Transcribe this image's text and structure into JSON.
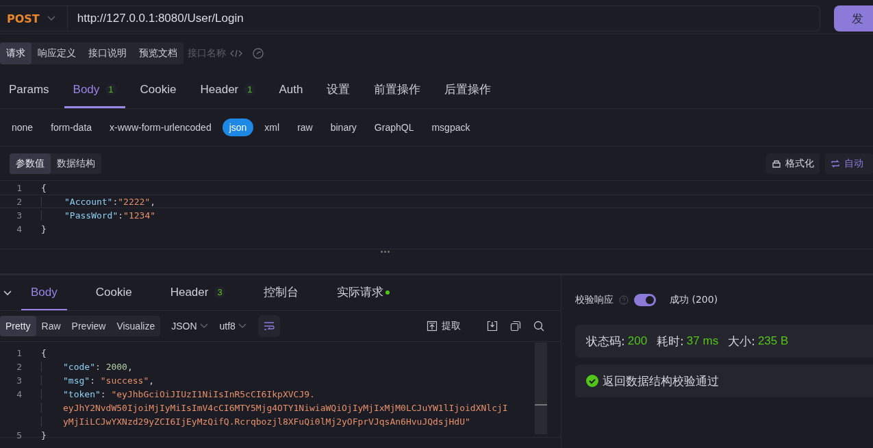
{
  "request_bar": {
    "method": "POST",
    "url": "http://127.0.0.1:8080/User/Login",
    "send_label": "发"
  },
  "doc_tabs": [
    {
      "label": "请求",
      "selected": true
    },
    {
      "label": "响应定义",
      "selected": false
    },
    {
      "label": "接口说明",
      "selected": false
    },
    {
      "label": "预览文档",
      "selected": false
    }
  ],
  "api_name": {
    "placeholder": "接口名称"
  },
  "request_tabs": [
    {
      "label": "Params",
      "selected": false
    },
    {
      "label": "Body",
      "count": "1",
      "selected": true
    },
    {
      "label": "Cookie",
      "selected": false
    },
    {
      "label": "Header",
      "count": "1",
      "selected": false
    },
    {
      "label": "Auth",
      "selected": false
    },
    {
      "label": "设置",
      "selected": false
    },
    {
      "label": "前置操作",
      "selected": false
    },
    {
      "label": "后置操作",
      "selected": false
    }
  ],
  "body_types": [
    {
      "label": "none",
      "selected": false
    },
    {
      "label": "form-data",
      "selected": false
    },
    {
      "label": "x-www-form-urlencoded",
      "selected": false
    },
    {
      "label": "json",
      "selected": true
    },
    {
      "label": "xml",
      "selected": false
    },
    {
      "label": "raw",
      "selected": false
    },
    {
      "label": "binary",
      "selected": false
    },
    {
      "label": "GraphQL",
      "selected": false
    },
    {
      "label": "msgpack",
      "selected": false
    }
  ],
  "editor_modes": [
    {
      "label": "参数值",
      "selected": true
    },
    {
      "label": "数据结构",
      "selected": false
    }
  ],
  "editor_actions": [
    {
      "label": "格式化",
      "kind": "format"
    },
    {
      "label": "自动",
      "kind": "auto"
    }
  ],
  "request_body": [
    {
      "num": "1",
      "kind": "brace",
      "parts": [
        {
          "kind": "punct",
          "text": "{"
        }
      ]
    },
    {
      "num": "2",
      "kind": "member",
      "parts": [
        {
          "kind": "key",
          "text": "\"Account\""
        },
        {
          "kind": "punct",
          "text": ":"
        },
        {
          "kind": "string",
          "text": "\"2222\""
        },
        {
          "kind": "punct",
          "text": ","
        }
      ]
    },
    {
      "num": "3",
      "kind": "member",
      "parts": [
        {
          "kind": "key",
          "text": "\"PassWord\""
        },
        {
          "kind": "punct",
          "text": ":"
        },
        {
          "kind": "string",
          "text": "\"1234\""
        }
      ]
    },
    {
      "num": "4",
      "kind": "brace",
      "parts": [
        {
          "kind": "punct",
          "text": "}"
        }
      ]
    }
  ],
  "response_tabs": [
    {
      "label": "Body",
      "selected": true
    },
    {
      "label": "Cookie",
      "selected": false
    },
    {
      "label": "Header",
      "count": "3",
      "selected": false
    },
    {
      "label": "控制台",
      "selected": false
    },
    {
      "label": "实际请求",
      "dot": true,
      "selected": false
    }
  ],
  "view_modes": [
    {
      "label": "Pretty",
      "selected": true
    },
    {
      "label": "Raw",
      "selected": false
    },
    {
      "label": "Preview",
      "selected": false
    },
    {
      "label": "Visualize",
      "selected": false
    }
  ],
  "format_select": "JSON",
  "encoding_select": "utf8",
  "response_actions": [
    {
      "kind": "extract",
      "label": "提取"
    },
    {
      "kind": "save"
    },
    {
      "kind": "copy"
    },
    {
      "kind": "search"
    }
  ],
  "response_body": [
    {
      "num": "1",
      "kind": "brace",
      "parts": [
        {
          "kind": "punct",
          "text": "{"
        }
      ]
    },
    {
      "num": "2",
      "kind": "member",
      "parts": [
        {
          "kind": "key",
          "text": "\"code\""
        },
        {
          "kind": "punct",
          "text": ": "
        },
        {
          "kind": "number",
          "text": "2000"
        },
        {
          "kind": "punct",
          "text": ","
        }
      ]
    },
    {
      "num": "3",
      "kind": "member",
      "parts": [
        {
          "kind": "key",
          "text": "\"msg\""
        },
        {
          "kind": "punct",
          "text": ": "
        },
        {
          "kind": "string",
          "text": "\"success\""
        },
        {
          "kind": "punct",
          "text": ","
        }
      ]
    },
    {
      "num": "4",
      "kind": "member",
      "parts": [
        {
          "kind": "key",
          "text": "\"token\""
        },
        {
          "kind": "punct",
          "text": ": "
        },
        {
          "kind": "string",
          "text": "\"eyJhbGciOiJIUzI1NiIsInR5cCI6IkpXVCJ9."
        }
      ]
    },
    {
      "kind": "wrap",
      "parts": [
        {
          "kind": "string",
          "text": "eyJhY2NvdW50IjoiMjIyMiIsImV4cCI6MTY5Mjg4OTY1NiwiaWQiOjIyMjIxMjM0LCJuYW1lIjoidXNlcjI"
        }
      ]
    },
    {
      "kind": "wrap",
      "parts": [
        {
          "kind": "string",
          "text": "yMjIiLCJwYXNzd29yZCI6IjEyMzQifQ.Rcrqbozjl8XFuQi0lMj2yOFprVJqsAn6HvuJQdsjHdU\""
        }
      ]
    },
    {
      "num": "5",
      "kind": "brace",
      "parts": [
        {
          "kind": "punct",
          "text": "}"
        }
      ]
    }
  ],
  "validation": {
    "label": "校验响应",
    "on": true,
    "result": "成功 (200)"
  },
  "stats": [
    {
      "label": "状态码:",
      "value": "200"
    },
    {
      "label": "耗时:",
      "value": "37 ms"
    },
    {
      "label": "大小:",
      "value": "235 B"
    }
  ],
  "schema_check": {
    "passed": true,
    "message": "返回数据结构校验通过"
  }
}
